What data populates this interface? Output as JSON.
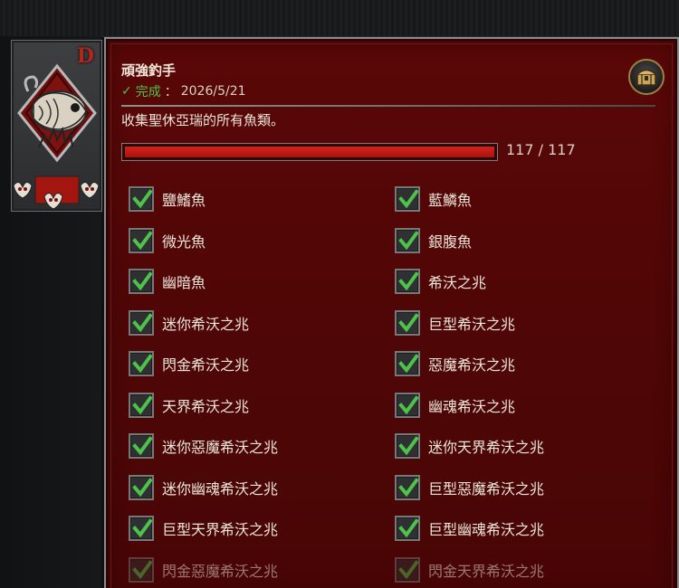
{
  "achievement": {
    "title": "頑強釣手",
    "completed_label": "完成",
    "completed_separator": "：",
    "completed_date": "2026/5/21",
    "description": "收集聖休亞瑞的所有魚類。",
    "progress": {
      "current": 117,
      "total": 117,
      "text": "117 / 117",
      "fraction": 1.0
    },
    "badge_letter": "D"
  },
  "items": [
    {
      "label": "鹽鰭魚",
      "checked": true
    },
    {
      "label": "藍鱗魚",
      "checked": true
    },
    {
      "label": "微光魚",
      "checked": true
    },
    {
      "label": "銀腹魚",
      "checked": true
    },
    {
      "label": "幽暗魚",
      "checked": true
    },
    {
      "label": "希沃之兆",
      "checked": true
    },
    {
      "label": "迷你希沃之兆",
      "checked": true
    },
    {
      "label": "巨型希沃之兆",
      "checked": true
    },
    {
      "label": "閃金希沃之兆",
      "checked": true
    },
    {
      "label": "惡魔希沃之兆",
      "checked": true
    },
    {
      "label": "天界希沃之兆",
      "checked": true
    },
    {
      "label": "幽魂希沃之兆",
      "checked": true
    },
    {
      "label": "迷你惡魔希沃之兆",
      "checked": true
    },
    {
      "label": "迷你天界希沃之兆",
      "checked": true
    },
    {
      "label": "迷你幽魂希沃之兆",
      "checked": true
    },
    {
      "label": "巨型惡魔希沃之兆",
      "checked": true
    },
    {
      "label": "巨型天界希沃之兆",
      "checked": true
    },
    {
      "label": "巨型幽魂希沃之兆",
      "checked": true
    },
    {
      "label": "閃金惡魔希沃之兆",
      "checked": true
    },
    {
      "label": "閃金天界希沃之兆",
      "checked": true
    }
  ],
  "colors": {
    "panel_red": "#540606",
    "progress_red": "#d3221a",
    "check_green": "#4ec34a",
    "badge_red": "#b3261e"
  },
  "icons": [
    "fish-emblem-icon",
    "horned-skull-icon",
    "reward-chest-icon",
    "checkmark-icon"
  ]
}
